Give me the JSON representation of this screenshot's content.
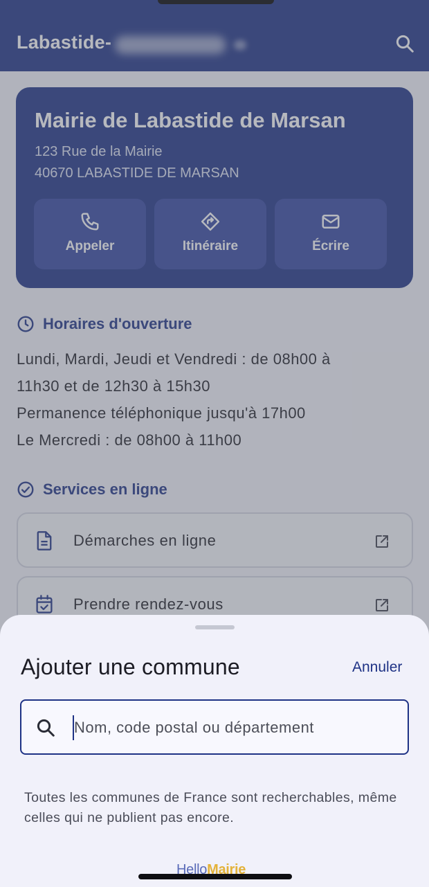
{
  "header": {
    "city_prefix": "Labastide-"
  },
  "mairie": {
    "name": "Mairie de Labastide de Marsan",
    "address_line1": "123 Rue de la Mairie",
    "address_line2": "40670 LABASTIDE DE MARSAN",
    "actions": [
      {
        "label": "Appeler",
        "icon": "phone-icon"
      },
      {
        "label": "Itinéraire",
        "icon": "directions-icon"
      },
      {
        "label": "Écrire",
        "icon": "mail-icon"
      }
    ]
  },
  "hours": {
    "title": "Horaires d'ouverture",
    "lines": [
      "Lundi, Mardi, Jeudi et Vendredi : de 08h00 à",
      "11h30 et de 12h30 à 15h30",
      "Permanence téléphonique jusqu'à 17h00",
      "Le Mercredi : de 08h00 à 11h00"
    ]
  },
  "services": {
    "title": "Services en ligne",
    "items": [
      {
        "label": "Démarches en ligne",
        "icon": "document-icon"
      },
      {
        "label": "Prendre rendez-vous",
        "icon": "calendar-check-icon"
      }
    ]
  },
  "sheet": {
    "title": "Ajouter une commune",
    "cancel_label": "Annuler",
    "search_placeholder": "Nom, code postal ou département",
    "search_value": "",
    "helper_text": "Toutes les communes de France sont recherchables, même celles qui ne publient pas encore.",
    "brand_part1": "Hello",
    "brand_part2": "Mairie"
  },
  "colors": {
    "primary": "#1e3285",
    "sheet_bg": "#f1f1fa",
    "brand_accent": "#e3b23a"
  }
}
